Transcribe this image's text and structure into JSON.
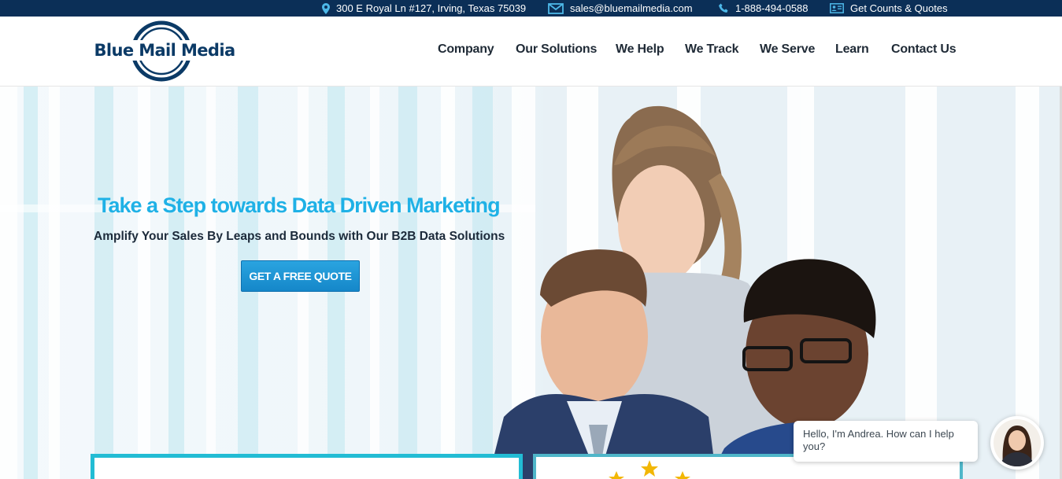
{
  "topbar": {
    "address": "300 E Royal Ln #127, Irving, Texas 75039",
    "email": "sales@bluemailmedia.com",
    "phone": "1-888-494-0588",
    "quote_link": "Get Counts & Quotes"
  },
  "header": {
    "logo_text": "Blue Mail Media",
    "nav": [
      "Company",
      "Our Solutions",
      "We Help",
      "We Track",
      "We Serve",
      "Learn",
      "Contact Us"
    ]
  },
  "hero": {
    "title": "Take a Step towards Data Driven Marketing",
    "subtitle": "Amplify Your Sales By Leaps and Bounds with Our B2B Data Solutions",
    "cta_label": "GET A FREE QUOTE"
  },
  "chat": {
    "message": "Hello, I'm Andrea. How can I help you?"
  },
  "colors": {
    "topbar_bg": "#0b2f57",
    "brand_navy": "#0b3a66",
    "hero_title": "#1fb1e6",
    "cta_blue": "#1a95d6",
    "card_border": "#22bcd4"
  },
  "icons": [
    "map-pin-icon",
    "envelope-icon",
    "phone-icon",
    "contact-card-icon",
    "star-icon"
  ]
}
